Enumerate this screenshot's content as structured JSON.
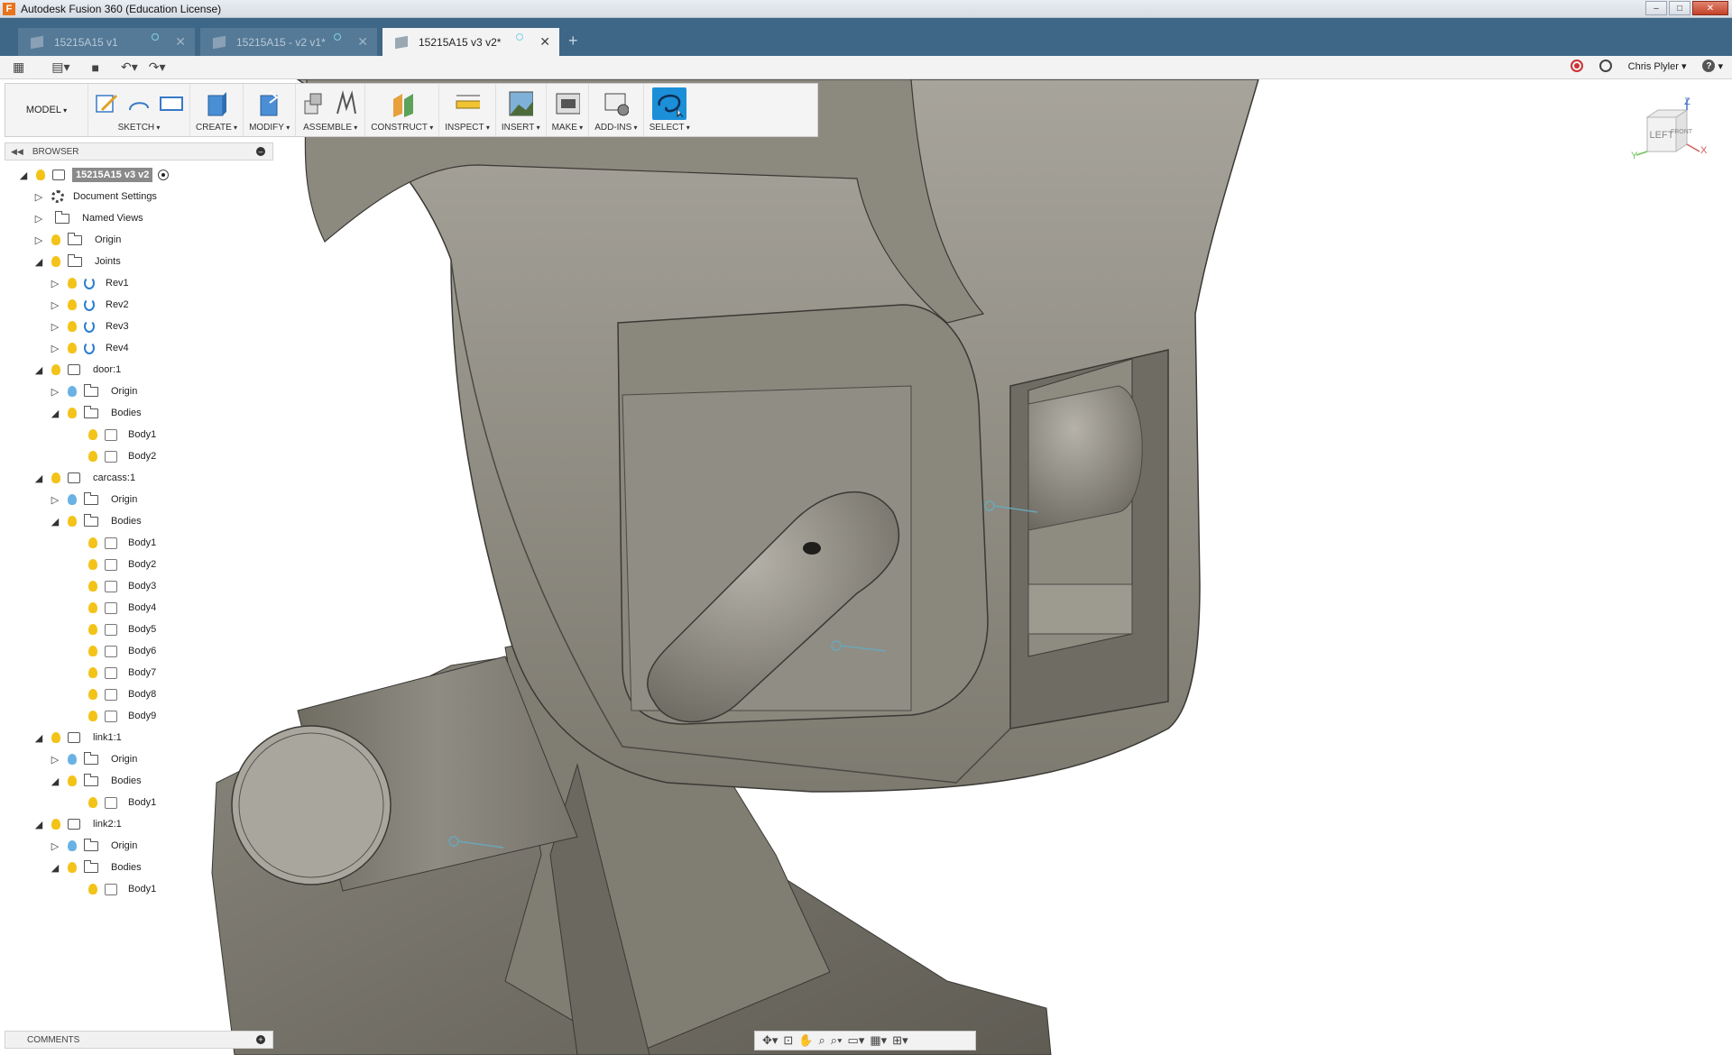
{
  "window": {
    "title": "Autodesk Fusion 360 (Education License)",
    "logo": "F"
  },
  "tabs": [
    {
      "label": "15215A15 v1",
      "active": false
    },
    {
      "label": "15215A15 - v2 v1*",
      "active": false
    },
    {
      "label": "15215A15 v3 v2*",
      "active": true
    }
  ],
  "quickbar": {
    "user": "Chris Plyler",
    "help": "?"
  },
  "toolbar": {
    "workspace": "MODEL",
    "groups": [
      "SKETCH",
      "CREATE",
      "MODIFY",
      "ASSEMBLE",
      "CONSTRUCT",
      "INSPECT",
      "INSERT",
      "MAKE",
      "ADD-INS",
      "SELECT"
    ]
  },
  "browser": {
    "title": "BROWSER",
    "root": "15215A15 v3 v2",
    "items": [
      {
        "label": "Document Settings"
      },
      {
        "label": "Named Views"
      },
      {
        "label": "Origin"
      },
      {
        "label": "Joints"
      },
      {
        "label": "Rev1"
      },
      {
        "label": "Rev2"
      },
      {
        "label": "Rev3"
      },
      {
        "label": "Rev4"
      },
      {
        "label": "door:1"
      },
      {
        "label": "Origin"
      },
      {
        "label": "Bodies"
      },
      {
        "label": "Body1"
      },
      {
        "label": "Body2"
      },
      {
        "label": "carcass:1"
      },
      {
        "label": "Origin"
      },
      {
        "label": "Bodies"
      },
      {
        "label": "Body1"
      },
      {
        "label": "Body2"
      },
      {
        "label": "Body3"
      },
      {
        "label": "Body4"
      },
      {
        "label": "Body5"
      },
      {
        "label": "Body6"
      },
      {
        "label": "Body7"
      },
      {
        "label": "Body8"
      },
      {
        "label": "Body9"
      },
      {
        "label": "link1:1"
      },
      {
        "label": "Origin"
      },
      {
        "label": "Bodies"
      },
      {
        "label": "Body1"
      },
      {
        "label": "link2:1"
      },
      {
        "label": "Origin"
      },
      {
        "label": "Bodies"
      },
      {
        "label": "Body1"
      }
    ]
  },
  "viewcube": {
    "face_left": "LEFT",
    "face_front": "FRONT",
    "axis_z": "Z",
    "axis_x": "X",
    "axis_y": "Y"
  },
  "comments": {
    "title": "COMMENTS"
  },
  "colors": {
    "accent": "#1b8fd8",
    "tabbar": "#3e6686",
    "model": "#8c8a80"
  }
}
